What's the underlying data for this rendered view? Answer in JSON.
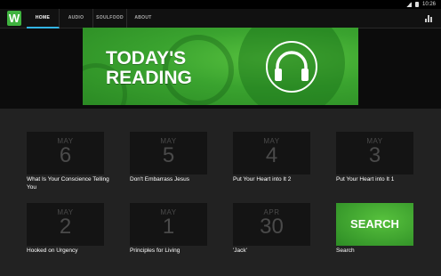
{
  "status_bar": {
    "time": "10:26"
  },
  "app": {
    "logo_letter": "W"
  },
  "tabs": [
    {
      "label": "HOME",
      "active": true
    },
    {
      "label": "AUDIO",
      "active": false
    },
    {
      "label": "SOULFOOD",
      "active": false
    },
    {
      "label": "ABOUT",
      "active": false
    }
  ],
  "banner": {
    "line1": "TODAY'S",
    "line2": "READING",
    "icon": "headphones-icon"
  },
  "readings": [
    {
      "month": "MAY",
      "day": "6",
      "title": "What Is Your Conscience Telling You"
    },
    {
      "month": "MAY",
      "day": "5",
      "title": "Don't Embarrass Jesus"
    },
    {
      "month": "MAY",
      "day": "4",
      "title": "Put Your Heart into It 2"
    },
    {
      "month": "MAY",
      "day": "3",
      "title": "Put Your Heart into It 1"
    },
    {
      "month": "MAY",
      "day": "2",
      "title": "Hooked on Urgency"
    },
    {
      "month": "MAY",
      "day": "1",
      "title": "Principles for Living"
    },
    {
      "month": "APR",
      "day": "30",
      "title": "'Jack'"
    }
  ],
  "search_tile": {
    "label": "SEARCH",
    "caption": "Search"
  },
  "colors": {
    "brand_green": "#3fb23f",
    "tab_indicator": "#33b5e5"
  }
}
